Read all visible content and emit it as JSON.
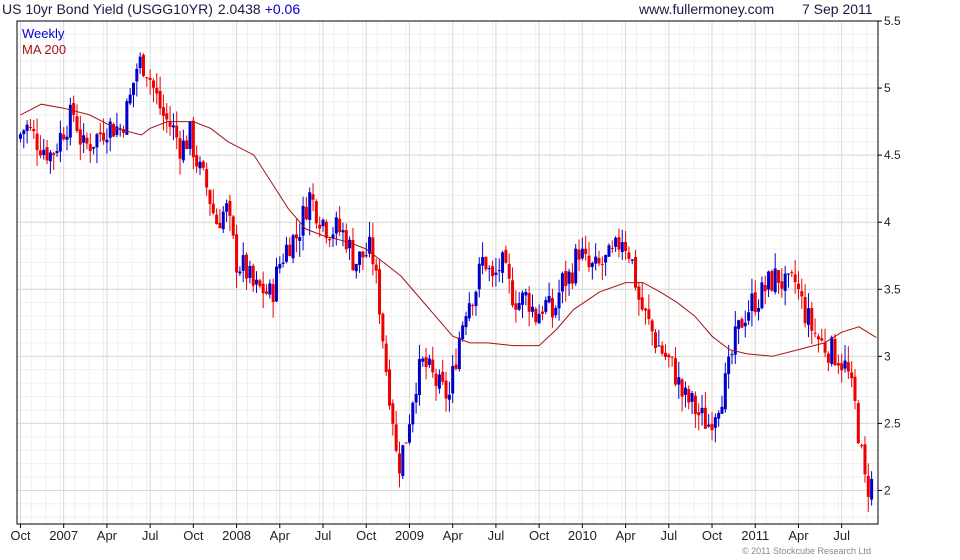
{
  "header": {
    "title": "US 10yr Bond Yield (USGG10YR)",
    "last_value": "2.0438",
    "change": "+0.06",
    "website": "www.fullermoney.com",
    "date": "7 Sep 2011"
  },
  "copyright": "© 2011 Stockcube Research Ltd",
  "colors": {
    "up": "#0000cc",
    "down": "#ee0000",
    "ma": "#aa1111",
    "grid": "#d8d8d8",
    "frame": "#000000"
  },
  "chart_data": {
    "type": "candlestick",
    "frequency": "Weekly",
    "legend": [
      "Weekly",
      "MA 200"
    ],
    "legend_placement": "top-left",
    "y_axis_position": "right",
    "ylim": [
      1.75,
      5.5
    ],
    "yticks": [
      "5.5",
      "5",
      "4.5",
      "4",
      "3.5",
      "3",
      "2.5",
      "2"
    ],
    "xlim": [
      2006.73,
      2011.71
    ],
    "xticks": [
      {
        "label": "Oct",
        "x": 2006.75
      },
      {
        "label": "2007",
        "x": 2007.0
      },
      {
        "label": "Apr",
        "x": 2007.25
      },
      {
        "label": "Jul",
        "x": 2007.5
      },
      {
        "label": "Oct",
        "x": 2007.75
      },
      {
        "label": "2008",
        "x": 2008.0
      },
      {
        "label": "Apr",
        "x": 2008.25
      },
      {
        "label": "Jul",
        "x": 2008.5
      },
      {
        "label": "Oct",
        "x": 2008.75
      },
      {
        "label": "2009",
        "x": 2009.0
      },
      {
        "label": "Apr",
        "x": 2009.25
      },
      {
        "label": "Jul",
        "x": 2009.5
      },
      {
        "label": "Oct",
        "x": 2009.75
      },
      {
        "label": "2010",
        "x": 2010.0
      },
      {
        "label": "Apr",
        "x": 2010.25
      },
      {
        "label": "Jul",
        "x": 2010.5
      },
      {
        "label": "Oct",
        "x": 2010.75
      },
      {
        "label": "2011",
        "x": 2011.0
      },
      {
        "label": "Apr",
        "x": 2011.25
      },
      {
        "label": "Jul",
        "x": 2011.5
      }
    ],
    "price_path": [
      [
        2006.75,
        4.62
      ],
      [
        2006.8,
        4.72
      ],
      [
        2006.87,
        4.6
      ],
      [
        2006.95,
        4.5
      ],
      [
        2007.02,
        4.7
      ],
      [
        2007.08,
        4.82
      ],
      [
        2007.13,
        4.55
      ],
      [
        2007.2,
        4.62
      ],
      [
        2007.27,
        4.72
      ],
      [
        2007.35,
        4.7
      ],
      [
        2007.4,
        4.9
      ],
      [
        2007.44,
        5.15
      ],
      [
        2007.47,
        5.2
      ],
      [
        2007.5,
        5.15
      ],
      [
        2007.55,
        4.95
      ],
      [
        2007.6,
        4.78
      ],
      [
        2007.65,
        4.7
      ],
      [
        2007.7,
        4.55
      ],
      [
        2007.75,
        4.65
      ],
      [
        2007.8,
        4.4
      ],
      [
        2007.85,
        4.25
      ],
      [
        2007.9,
        4.0
      ],
      [
        2007.96,
        4.1
      ],
      [
        2008.02,
        3.7
      ],
      [
        2008.07,
        3.65
      ],
      [
        2008.12,
        3.5
      ],
      [
        2008.17,
        3.5
      ],
      [
        2008.22,
        3.45
      ],
      [
        2008.27,
        3.7
      ],
      [
        2008.32,
        3.85
      ],
      [
        2008.37,
        3.9
      ],
      [
        2008.44,
        4.2
      ],
      [
        2008.5,
        4.05
      ],
      [
        2008.55,
        3.95
      ],
      [
        2008.6,
        3.95
      ],
      [
        2008.65,
        3.9
      ],
      [
        2008.7,
        3.7
      ],
      [
        2008.75,
        3.75
      ],
      [
        2008.8,
        3.8
      ],
      [
        2008.85,
        3.35
      ],
      [
        2008.88,
        2.95
      ],
      [
        2008.92,
        2.6
      ],
      [
        2008.95,
        2.15
      ],
      [
        2009.0,
        2.4
      ],
      [
        2009.05,
        2.8
      ],
      [
        2009.1,
        2.95
      ],
      [
        2009.15,
        2.85
      ],
      [
        2009.2,
        2.75
      ],
      [
        2009.25,
        2.7
      ],
      [
        2009.3,
        3.1
      ],
      [
        2009.35,
        3.4
      ],
      [
        2009.4,
        3.5
      ],
      [
        2009.45,
        3.75
      ],
      [
        2009.5,
        3.55
      ],
      [
        2009.55,
        3.7
      ],
      [
        2009.6,
        3.5
      ],
      [
        2009.65,
        3.4
      ],
      [
        2009.7,
        3.45
      ],
      [
        2009.75,
        3.3
      ],
      [
        2009.8,
        3.4
      ],
      [
        2009.85,
        3.3
      ],
      [
        2009.9,
        3.55
      ],
      [
        2009.95,
        3.6
      ],
      [
        2010.0,
        3.8
      ],
      [
        2010.05,
        3.65
      ],
      [
        2010.1,
        3.65
      ],
      [
        2010.15,
        3.7
      ],
      [
        2010.2,
        3.75
      ],
      [
        2010.25,
        3.9
      ],
      [
        2010.3,
        3.75
      ],
      [
        2010.35,
        3.4
      ],
      [
        2010.4,
        3.25
      ],
      [
        2010.45,
        3.1
      ],
      [
        2010.5,
        3.0
      ],
      [
        2010.55,
        2.9
      ],
      [
        2010.6,
        2.7
      ],
      [
        2010.65,
        2.65
      ],
      [
        2010.7,
        2.55
      ],
      [
        2010.75,
        2.5
      ],
      [
        2010.8,
        2.65
      ],
      [
        2010.85,
        2.8
      ],
      [
        2010.9,
        3.1
      ],
      [
        2010.95,
        3.3
      ],
      [
        2011.0,
        3.4
      ],
      [
        2011.05,
        3.45
      ],
      [
        2011.1,
        3.55
      ],
      [
        2011.15,
        3.6
      ],
      [
        2011.2,
        3.5
      ],
      [
        2011.25,
        3.55
      ],
      [
        2011.3,
        3.35
      ],
      [
        2011.35,
        3.2
      ],
      [
        2011.4,
        3.1
      ],
      [
        2011.45,
        3.05
      ],
      [
        2011.5,
        3.0
      ],
      [
        2011.55,
        2.9
      ],
      [
        2011.6,
        2.6
      ],
      [
        2011.63,
        2.3
      ],
      [
        2011.66,
        2.0
      ],
      [
        2011.68,
        2.05
      ]
    ],
    "ma_200": [
      [
        2006.75,
        4.8
      ],
      [
        2006.87,
        4.88
      ],
      [
        2007.0,
        4.85
      ],
      [
        2007.15,
        4.8
      ],
      [
        2007.3,
        4.7
      ],
      [
        2007.45,
        4.65
      ],
      [
        2007.5,
        4.7
      ],
      [
        2007.6,
        4.75
      ],
      [
        2007.75,
        4.75
      ],
      [
        2007.85,
        4.7
      ],
      [
        2007.95,
        4.6
      ],
      [
        2008.1,
        4.5
      ],
      [
        2008.2,
        4.3
      ],
      [
        2008.3,
        4.1
      ],
      [
        2008.4,
        3.95
      ],
      [
        2008.5,
        3.9
      ],
      [
        2008.65,
        3.85
      ],
      [
        2008.75,
        3.8
      ],
      [
        2008.85,
        3.7
      ],
      [
        2008.95,
        3.6
      ],
      [
        2009.05,
        3.45
      ],
      [
        2009.15,
        3.3
      ],
      [
        2009.25,
        3.15
      ],
      [
        2009.35,
        3.1
      ],
      [
        2009.45,
        3.1
      ],
      [
        2009.6,
        3.08
      ],
      [
        2009.75,
        3.08
      ],
      [
        2009.85,
        3.2
      ],
      [
        2009.95,
        3.35
      ],
      [
        2010.1,
        3.48
      ],
      [
        2010.25,
        3.55
      ],
      [
        2010.35,
        3.55
      ],
      [
        2010.45,
        3.48
      ],
      [
        2010.55,
        3.4
      ],
      [
        2010.65,
        3.3
      ],
      [
        2010.75,
        3.15
      ],
      [
        2010.85,
        3.05
      ],
      [
        2010.95,
        3.02
      ],
      [
        2011.1,
        3.0
      ],
      [
        2011.25,
        3.05
      ],
      [
        2011.4,
        3.1
      ],
      [
        2011.5,
        3.18
      ],
      [
        2011.6,
        3.22
      ],
      [
        2011.7,
        3.14
      ]
    ]
  }
}
